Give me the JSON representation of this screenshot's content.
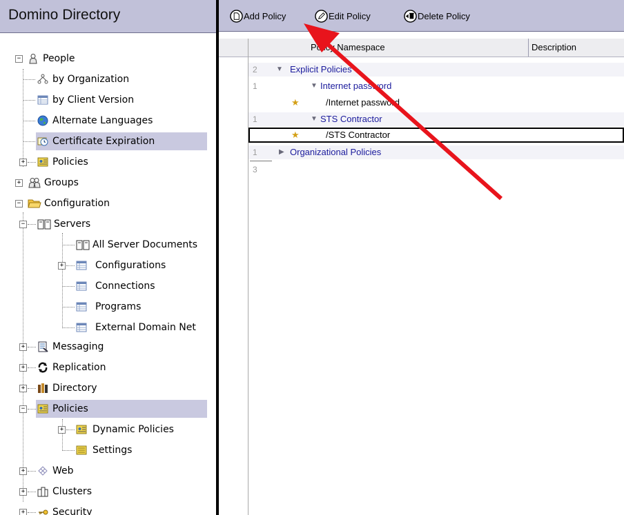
{
  "navigator": {
    "title": "Domino Directory",
    "items": [
      {
        "label": "People"
      },
      {
        "label": "by Organization"
      },
      {
        "label": "by Client Version"
      },
      {
        "label": "Alternate Languages"
      },
      {
        "label": "Certificate Expiration"
      },
      {
        "label": "Policies"
      },
      {
        "label": "Groups"
      },
      {
        "label": "Configuration"
      },
      {
        "label": "Servers"
      },
      {
        "label": "All Server Documents"
      },
      {
        "label": "Configurations"
      },
      {
        "label": "Connections"
      },
      {
        "label": "Programs"
      },
      {
        "label": "External Domain Net"
      },
      {
        "label": "Messaging"
      },
      {
        "label": "Replication"
      },
      {
        "label": "Directory"
      },
      {
        "label": "Policies"
      },
      {
        "label": "Dynamic Policies"
      },
      {
        "label": "Settings"
      },
      {
        "label": "Web"
      },
      {
        "label": "Clusters"
      },
      {
        "label": "Security"
      }
    ]
  },
  "toolbar": {
    "add_label": "Add Policy",
    "edit_label": "Edit Policy",
    "delete_label": "Delete Policy"
  },
  "view": {
    "columns": [
      "Policy Namespace",
      "Description"
    ],
    "rows": [
      {
        "count": "2",
        "text": "Explicit Policies"
      },
      {
        "count": "1",
        "text": "Internet password"
      },
      {
        "count": "",
        "text": "/Internet password"
      },
      {
        "count": "1",
        "text": "STS Contractor"
      },
      {
        "count": "",
        "text": "/STS Contractor"
      },
      {
        "count": "1",
        "text": "Organizational Policies"
      },
      {
        "count": "3",
        "text": ""
      }
    ]
  },
  "colors": {
    "header_bg": "#c1c1d9",
    "selection_bg": "#c9c9e0",
    "category_text": "#1a1a9c",
    "annotation_arrow": "#e8141c"
  }
}
